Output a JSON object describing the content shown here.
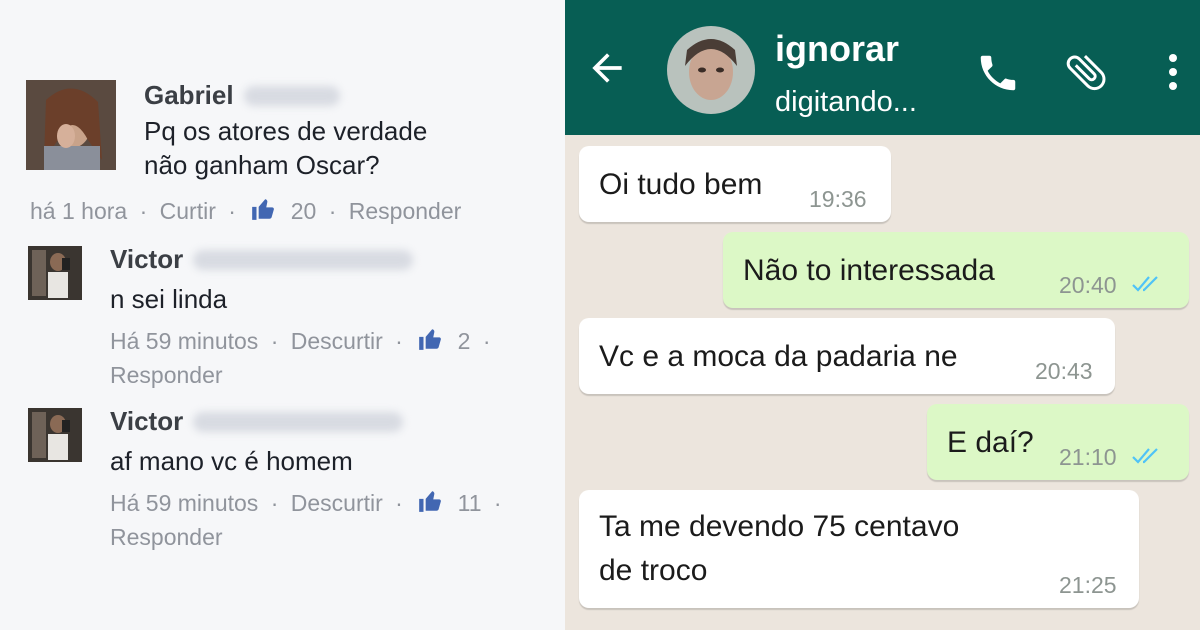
{
  "facebook": {
    "comments": [
      {
        "name": "Gabriel",
        "text_lines": [
          "Pq os atores de verdade",
          "não ganham Oscar?"
        ],
        "time": "há 1 hora",
        "like_action": "Curtir",
        "likes": "20",
        "reply": "Responder"
      },
      {
        "name": "Victor",
        "text_lines": [
          "n sei linda"
        ],
        "time": "Há 59 minutos",
        "like_action": "Descurtir",
        "likes": "2",
        "reply": "Responder"
      },
      {
        "name": "Victor",
        "text_lines": [
          "af mano vc é homem"
        ],
        "time": "Há 59 minutos",
        "like_action": "Descurtir",
        "likes": "11",
        "reply": "Responder"
      }
    ],
    "separator": "·",
    "like_icon": "thumbs-up-icon",
    "like_color": "#4267b2"
  },
  "whatsapp": {
    "contact_name": "ignorar",
    "status": "digitando...",
    "icons": [
      "back-arrow-icon",
      "phone-icon",
      "paperclip-icon",
      "more-vert-icon"
    ],
    "header_color": "#075e54",
    "outgoing_bubble_color": "#dcf8c6",
    "read_tick_color": "#4fc3f7",
    "messages": [
      {
        "direction": "in",
        "lines": [
          "Oi tudo bem"
        ],
        "time": "19:36"
      },
      {
        "direction": "out",
        "lines": [
          "Não to interessada"
        ],
        "time": "20:40",
        "read": true
      },
      {
        "direction": "in",
        "lines": [
          "Vc e a moca da padaria ne"
        ],
        "time": "20:43"
      },
      {
        "direction": "out",
        "lines": [
          "E daí?"
        ],
        "time": "21:10",
        "read": true
      },
      {
        "direction": "in",
        "lines": [
          "Ta me devendo 75 centavo",
          "de troco"
        ],
        "time": "21:25"
      }
    ]
  }
}
